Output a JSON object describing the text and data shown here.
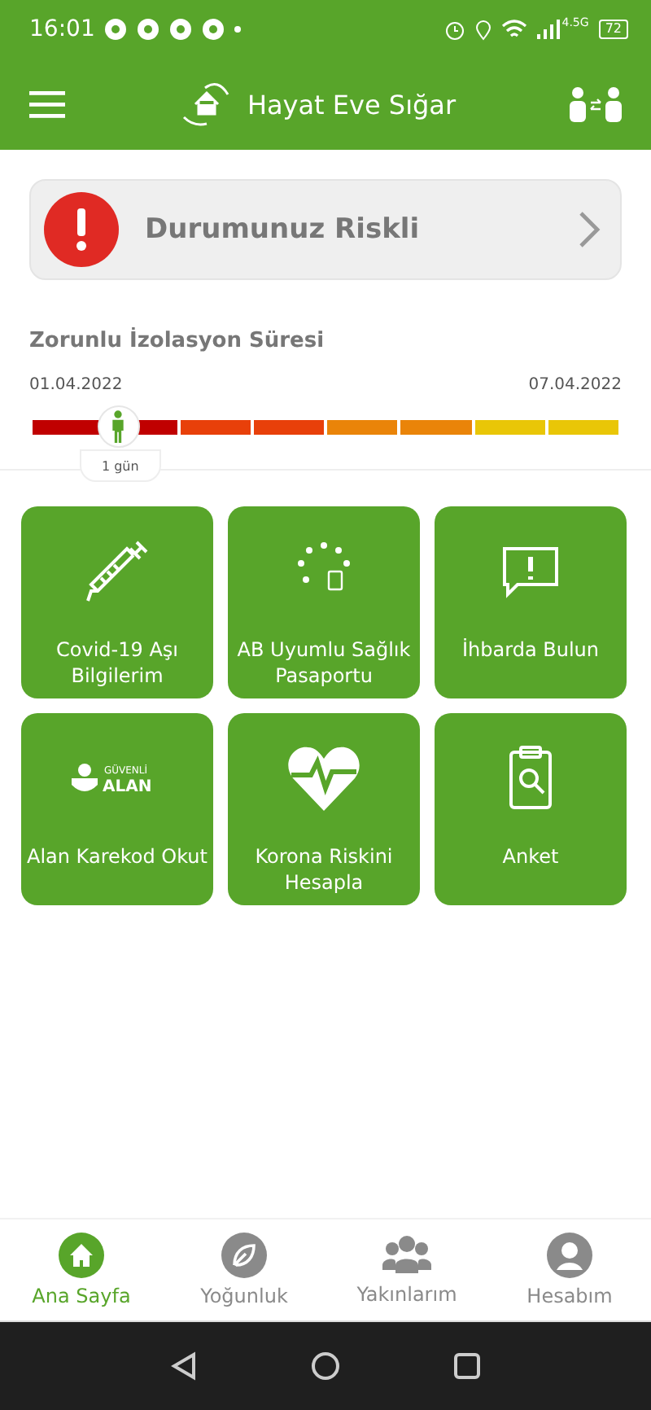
{
  "status_bar": {
    "time": "16:01",
    "network": "4.5G",
    "battery": "72"
  },
  "app_bar": {
    "title": "Hayat Eve Sığar"
  },
  "status_card": {
    "text": "Durumunuz Riskli"
  },
  "isolation": {
    "title": "Zorunlu İzolasyon Süresi",
    "start_date": "01.04.2022",
    "end_date": "07.04.2022",
    "marker_label": "1 gün",
    "segments": [
      {
        "color": "#c00000"
      },
      {
        "color": "#c00000"
      },
      {
        "color": "#e8400a"
      },
      {
        "color": "#e8400a"
      },
      {
        "color": "#ea8409"
      },
      {
        "color": "#ea8409"
      },
      {
        "color": "#e9c607"
      },
      {
        "color": "#e9c607"
      }
    ]
  },
  "tiles": [
    {
      "kind": "syringe",
      "label": "Covid-19 Aşı Bilgilerim"
    },
    {
      "kind": "stars",
      "label": "AB Uyumlu Sağlık Pasaportu"
    },
    {
      "kind": "alert",
      "label": "İhbarda Bulun"
    },
    {
      "kind": "area",
      "label": "Alan Karekod Okut",
      "badge_top": "GÜVENLİ",
      "badge_bottom": "ALAN"
    },
    {
      "kind": "heart",
      "label": "Korona Riskini Hesapla"
    },
    {
      "kind": "clipboard",
      "label": "Anket"
    }
  ],
  "bottom_nav": [
    {
      "kind": "home",
      "label": "Ana Sayfa",
      "selected": true
    },
    {
      "kind": "leaf",
      "label": "Yoğunluk",
      "selected": false
    },
    {
      "kind": "people",
      "label": "Yakınlarım",
      "selected": false
    },
    {
      "kind": "account",
      "label": "Hesabım",
      "selected": false
    }
  ]
}
